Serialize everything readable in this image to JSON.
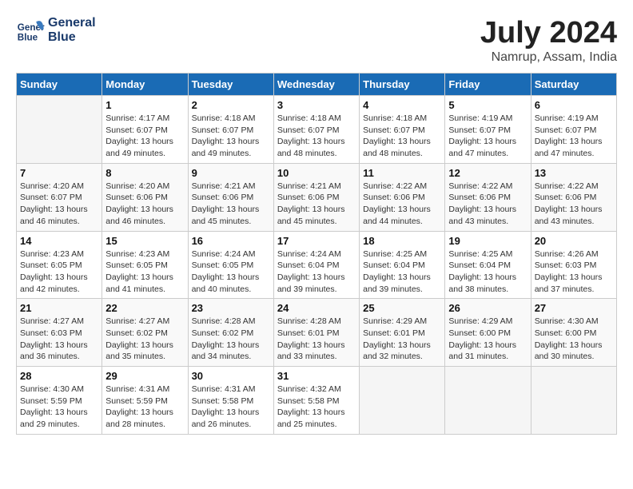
{
  "header": {
    "logo_line1": "General",
    "logo_line2": "Blue",
    "month_year": "July 2024",
    "location": "Namrup, Assam, India"
  },
  "weekdays": [
    "Sunday",
    "Monday",
    "Tuesday",
    "Wednesday",
    "Thursday",
    "Friday",
    "Saturday"
  ],
  "weeks": [
    [
      {
        "day": "",
        "info": ""
      },
      {
        "day": "1",
        "info": "Sunrise: 4:17 AM\nSunset: 6:07 PM\nDaylight: 13 hours\nand 49 minutes."
      },
      {
        "day": "2",
        "info": "Sunrise: 4:18 AM\nSunset: 6:07 PM\nDaylight: 13 hours\nand 49 minutes."
      },
      {
        "day": "3",
        "info": "Sunrise: 4:18 AM\nSunset: 6:07 PM\nDaylight: 13 hours\nand 48 minutes."
      },
      {
        "day": "4",
        "info": "Sunrise: 4:18 AM\nSunset: 6:07 PM\nDaylight: 13 hours\nand 48 minutes."
      },
      {
        "day": "5",
        "info": "Sunrise: 4:19 AM\nSunset: 6:07 PM\nDaylight: 13 hours\nand 47 minutes."
      },
      {
        "day": "6",
        "info": "Sunrise: 4:19 AM\nSunset: 6:07 PM\nDaylight: 13 hours\nand 47 minutes."
      }
    ],
    [
      {
        "day": "7",
        "info": "Sunrise: 4:20 AM\nSunset: 6:07 PM\nDaylight: 13 hours\nand 46 minutes."
      },
      {
        "day": "8",
        "info": "Sunrise: 4:20 AM\nSunset: 6:06 PM\nDaylight: 13 hours\nand 46 minutes."
      },
      {
        "day": "9",
        "info": "Sunrise: 4:21 AM\nSunset: 6:06 PM\nDaylight: 13 hours\nand 45 minutes."
      },
      {
        "day": "10",
        "info": "Sunrise: 4:21 AM\nSunset: 6:06 PM\nDaylight: 13 hours\nand 45 minutes."
      },
      {
        "day": "11",
        "info": "Sunrise: 4:22 AM\nSunset: 6:06 PM\nDaylight: 13 hours\nand 44 minutes."
      },
      {
        "day": "12",
        "info": "Sunrise: 4:22 AM\nSunset: 6:06 PM\nDaylight: 13 hours\nand 43 minutes."
      },
      {
        "day": "13",
        "info": "Sunrise: 4:22 AM\nSunset: 6:06 PM\nDaylight: 13 hours\nand 43 minutes."
      }
    ],
    [
      {
        "day": "14",
        "info": "Sunrise: 4:23 AM\nSunset: 6:05 PM\nDaylight: 13 hours\nand 42 minutes."
      },
      {
        "day": "15",
        "info": "Sunrise: 4:23 AM\nSunset: 6:05 PM\nDaylight: 13 hours\nand 41 minutes."
      },
      {
        "day": "16",
        "info": "Sunrise: 4:24 AM\nSunset: 6:05 PM\nDaylight: 13 hours\nand 40 minutes."
      },
      {
        "day": "17",
        "info": "Sunrise: 4:24 AM\nSunset: 6:04 PM\nDaylight: 13 hours\nand 39 minutes."
      },
      {
        "day": "18",
        "info": "Sunrise: 4:25 AM\nSunset: 6:04 PM\nDaylight: 13 hours\nand 39 minutes."
      },
      {
        "day": "19",
        "info": "Sunrise: 4:25 AM\nSunset: 6:04 PM\nDaylight: 13 hours\nand 38 minutes."
      },
      {
        "day": "20",
        "info": "Sunrise: 4:26 AM\nSunset: 6:03 PM\nDaylight: 13 hours\nand 37 minutes."
      }
    ],
    [
      {
        "day": "21",
        "info": "Sunrise: 4:27 AM\nSunset: 6:03 PM\nDaylight: 13 hours\nand 36 minutes."
      },
      {
        "day": "22",
        "info": "Sunrise: 4:27 AM\nSunset: 6:02 PM\nDaylight: 13 hours\nand 35 minutes."
      },
      {
        "day": "23",
        "info": "Sunrise: 4:28 AM\nSunset: 6:02 PM\nDaylight: 13 hours\nand 34 minutes."
      },
      {
        "day": "24",
        "info": "Sunrise: 4:28 AM\nSunset: 6:01 PM\nDaylight: 13 hours\nand 33 minutes."
      },
      {
        "day": "25",
        "info": "Sunrise: 4:29 AM\nSunset: 6:01 PM\nDaylight: 13 hours\nand 32 minutes."
      },
      {
        "day": "26",
        "info": "Sunrise: 4:29 AM\nSunset: 6:00 PM\nDaylight: 13 hours\nand 31 minutes."
      },
      {
        "day": "27",
        "info": "Sunrise: 4:30 AM\nSunset: 6:00 PM\nDaylight: 13 hours\nand 30 minutes."
      }
    ],
    [
      {
        "day": "28",
        "info": "Sunrise: 4:30 AM\nSunset: 5:59 PM\nDaylight: 13 hours\nand 29 minutes."
      },
      {
        "day": "29",
        "info": "Sunrise: 4:31 AM\nSunset: 5:59 PM\nDaylight: 13 hours\nand 28 minutes."
      },
      {
        "day": "30",
        "info": "Sunrise: 4:31 AM\nSunset: 5:58 PM\nDaylight: 13 hours\nand 26 minutes."
      },
      {
        "day": "31",
        "info": "Sunrise: 4:32 AM\nSunset: 5:58 PM\nDaylight: 13 hours\nand 25 minutes."
      },
      {
        "day": "",
        "info": ""
      },
      {
        "day": "",
        "info": ""
      },
      {
        "day": "",
        "info": ""
      }
    ]
  ]
}
